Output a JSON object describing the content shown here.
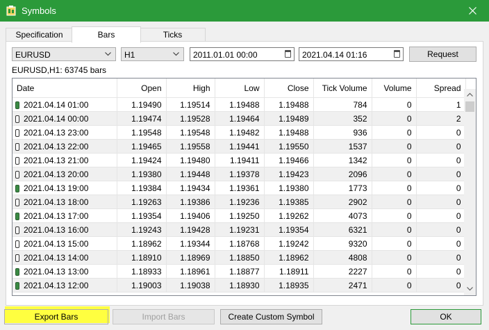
{
  "window": {
    "title": "Symbols"
  },
  "tabs": [
    {
      "label": "Specification"
    },
    {
      "label": "Bars"
    },
    {
      "label": "Ticks"
    }
  ],
  "toolbar": {
    "symbol": "EURUSD",
    "timeframe": "H1",
    "from": "2011.01.01 00:00",
    "to": "2021.04.14 01:16",
    "request_label": "Request"
  },
  "summary": "EURUSD,H1: 63745 bars",
  "table": {
    "headers": [
      "Date",
      "Open",
      "High",
      "Low",
      "Close",
      "Tick Volume",
      "Volume",
      "Spread"
    ],
    "rows": [
      {
        "dir": "bull",
        "cells": [
          "2021.04.14 01:00",
          "1.19490",
          "1.19514",
          "1.19488",
          "1.19488",
          "784",
          "0",
          "1"
        ]
      },
      {
        "dir": "bear",
        "cells": [
          "2021.04.14 00:00",
          "1.19474",
          "1.19528",
          "1.19464",
          "1.19489",
          "352",
          "0",
          "2"
        ]
      },
      {
        "dir": "bear",
        "cells": [
          "2021.04.13 23:00",
          "1.19548",
          "1.19548",
          "1.19482",
          "1.19488",
          "936",
          "0",
          "0"
        ]
      },
      {
        "dir": "bear",
        "cells": [
          "2021.04.13 22:00",
          "1.19465",
          "1.19558",
          "1.19441",
          "1.19550",
          "1537",
          "0",
          "0"
        ]
      },
      {
        "dir": "bear",
        "cells": [
          "2021.04.13 21:00",
          "1.19424",
          "1.19480",
          "1.19411",
          "1.19466",
          "1342",
          "0",
          "0"
        ]
      },
      {
        "dir": "bear",
        "cells": [
          "2021.04.13 20:00",
          "1.19380",
          "1.19448",
          "1.19378",
          "1.19423",
          "2096",
          "0",
          "0"
        ]
      },
      {
        "dir": "bull",
        "cells": [
          "2021.04.13 19:00",
          "1.19384",
          "1.19434",
          "1.19361",
          "1.19380",
          "1773",
          "0",
          "0"
        ]
      },
      {
        "dir": "bear",
        "cells": [
          "2021.04.13 18:00",
          "1.19263",
          "1.19386",
          "1.19236",
          "1.19385",
          "2902",
          "0",
          "0"
        ]
      },
      {
        "dir": "bull",
        "cells": [
          "2021.04.13 17:00",
          "1.19354",
          "1.19406",
          "1.19250",
          "1.19262",
          "4073",
          "0",
          "0"
        ]
      },
      {
        "dir": "bear",
        "cells": [
          "2021.04.13 16:00",
          "1.19243",
          "1.19428",
          "1.19231",
          "1.19354",
          "6321",
          "0",
          "0"
        ]
      },
      {
        "dir": "bear",
        "cells": [
          "2021.04.13 15:00",
          "1.18962",
          "1.19344",
          "1.18768",
          "1.19242",
          "9320",
          "0",
          "0"
        ]
      },
      {
        "dir": "bear",
        "cells": [
          "2021.04.13 14:00",
          "1.18910",
          "1.18969",
          "1.18850",
          "1.18962",
          "4808",
          "0",
          "0"
        ]
      },
      {
        "dir": "bull",
        "cells": [
          "2021.04.13 13:00",
          "1.18933",
          "1.18961",
          "1.18877",
          "1.18911",
          "2227",
          "0",
          "0"
        ]
      },
      {
        "dir": "bull",
        "cells": [
          "2021.04.13 12:00",
          "1.19003",
          "1.19038",
          "1.18930",
          "1.18935",
          "2471",
          "0",
          "0"
        ]
      }
    ]
  },
  "buttons": {
    "export": "Export Bars",
    "import": "Import Bars",
    "custom": "Create Custom Symbol",
    "ok": "OK"
  },
  "colors": {
    "titlebar": "#2b9a3a",
    "highlight": "#ffff40",
    "bull_candle": "#3a8a44"
  },
  "icons": {
    "app": "symbols-app-icon",
    "close": "close-icon",
    "calendar": "calendar-icon",
    "dropdown": "chevron-down-icon"
  }
}
